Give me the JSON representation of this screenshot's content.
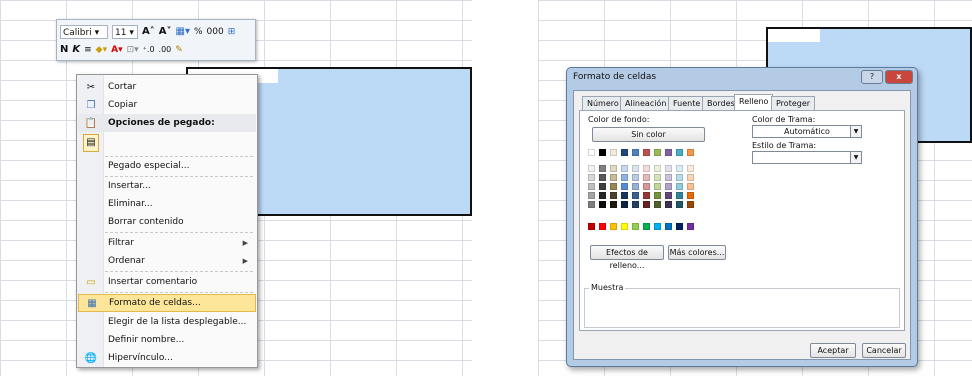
{
  "mini_toolbar": {
    "font_name": "Calibri",
    "font_size": "11",
    "percent": "%",
    "thousands": "000",
    "bold": "N",
    "italic": "K"
  },
  "context_menu": {
    "items": [
      {
        "label": "Cortar",
        "icon": "scissors-icon"
      },
      {
        "label": "Copiar",
        "icon": "copy-icon"
      },
      {
        "label": "Opciones de pegado:",
        "icon": "paste-icon"
      },
      {
        "label": "Pegado especial..."
      },
      {
        "label": "Insertar..."
      },
      {
        "label": "Eliminar..."
      },
      {
        "label": "Borrar contenido"
      },
      {
        "label": "Filtrar",
        "submenu": true
      },
      {
        "label": "Ordenar",
        "submenu": true
      },
      {
        "label": "Insertar comentario",
        "icon": "comment-icon"
      },
      {
        "label": "Formato de celdas...",
        "icon": "format-cells-icon",
        "highlighted": true
      },
      {
        "label": "Elegir de la lista desplegable..."
      },
      {
        "label": "Definir nombre..."
      },
      {
        "label": "Hipervínculo...",
        "icon": "hyperlink-icon"
      }
    ]
  },
  "dialog": {
    "title": "Formato de celdas",
    "help_button": "?",
    "close_button": "x",
    "tabs": [
      "Número",
      "Alineación",
      "Fuente",
      "Bordes",
      "Relleno",
      "Proteger"
    ],
    "active_tab": "Relleno",
    "color_fondo_label": "Color de fondo:",
    "sin_color_button": "Sin color",
    "color_trama_label": "Color de Trama:",
    "color_trama_value": "Automático",
    "estilo_trama_label": "Estilo de Trama:",
    "estilo_trama_value": "",
    "efectos_button": "Efectos de relleno...",
    "mas_colores_button": "Más colores...",
    "muestra_label": "Muestra",
    "aceptar_button": "Aceptar",
    "cancelar_button": "Cancelar",
    "palette_row1": [
      "#ffffff",
      "#000000",
      "#eeece1",
      "#1f497d",
      "#4f81bd",
      "#c0504d",
      "#9bbb59",
      "#8064a2",
      "#4bacc6",
      "#f79646"
    ],
    "palette_tints": [
      [
        "#f2f2f2",
        "#7f7f7f",
        "#ddd9c3",
        "#c6d9f0",
        "#dbe5f1",
        "#f2dcdb",
        "#ebf1dd",
        "#e5e0ec",
        "#dbeef3",
        "#fdeada"
      ],
      [
        "#d8d8d8",
        "#595959",
        "#c4bd97",
        "#8db3e2",
        "#b8cce4",
        "#e5b9b7",
        "#d7e3bc",
        "#ccc1d9",
        "#b7dde8",
        "#fbd5b5"
      ],
      [
        "#bfbfbf",
        "#3f3f3f",
        "#938953",
        "#548dd4",
        "#95b3d7",
        "#d99694",
        "#c3d69b",
        "#b2a2c7",
        "#92cddc",
        "#fac08f"
      ],
      [
        "#a5a5a5",
        "#262626",
        "#494429",
        "#17365d",
        "#366092",
        "#953734",
        "#76923c",
        "#5f497a",
        "#31859b",
        "#e36c09"
      ],
      [
        "#7f7f7f",
        "#0c0c0c",
        "#1d1b10",
        "#0f243e",
        "#244061",
        "#632423",
        "#4f6128",
        "#3f3151",
        "#205867",
        "#974806"
      ]
    ],
    "palette_standard": [
      "#c00000",
      "#ff0000",
      "#ffc000",
      "#ffff00",
      "#92d050",
      "#00b050",
      "#00b0f0",
      "#0070c0",
      "#002060",
      "#7030a0"
    ]
  }
}
